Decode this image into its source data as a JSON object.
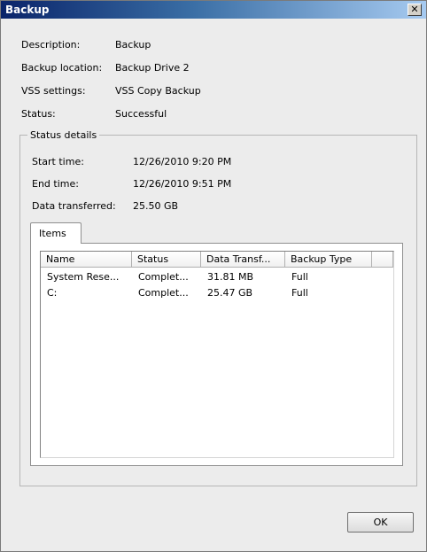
{
  "window": {
    "title": "Backup",
    "close_symbol": "✕"
  },
  "summary": {
    "description_label": "Description:",
    "description_value": "Backup",
    "location_label": "Backup location:",
    "location_value": "Backup Drive 2",
    "vss_label": "VSS settings:",
    "vss_value": "VSS Copy Backup",
    "status_label": "Status:",
    "status_value": "Successful"
  },
  "status_details": {
    "legend": "Status details",
    "start_label": "Start time:",
    "start_value": "12/26/2010 9:20 PM",
    "end_label": "End time:",
    "end_value": "12/26/2010 9:51 PM",
    "data_label": "Data transferred:",
    "data_value": "25.50 GB"
  },
  "items_tab": {
    "label": "Items",
    "columns": [
      "Name",
      "Status",
      "Data Transf...",
      "Backup Type"
    ],
    "rows": [
      [
        "System Rese...",
        "Complet...",
        "31.81 MB",
        "Full"
      ],
      [
        "C:",
        "Complet...",
        "25.47 GB",
        "Full"
      ]
    ]
  },
  "buttons": {
    "ok": "OK"
  }
}
